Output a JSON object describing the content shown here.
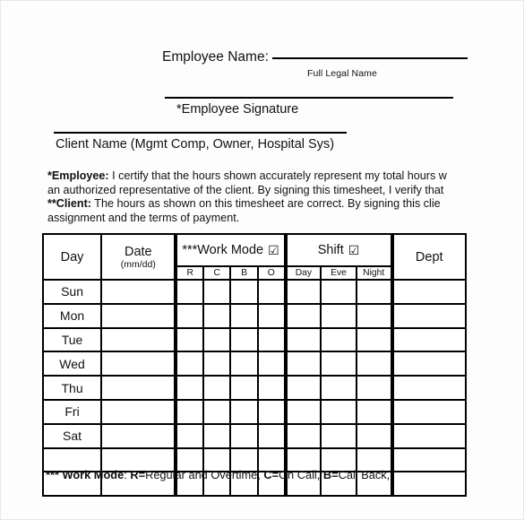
{
  "header": {
    "employee_name_label": "Employee Name:",
    "full_legal_name_caption": "Full Legal Name",
    "employee_signature_label": "*Employee Signature",
    "client_name_label": "Client Name (Mgmt Comp, Owner, Hospital Sys)"
  },
  "certification": {
    "employee_marker": "*Employee:",
    "employee_line1": " I certify that the hours shown accurately represent my total hours w",
    "employee_line2": "an authorized representative of the client. By signing this timesheet, I verify that",
    "client_marker": "**Client:",
    "client_line1": "  The hours as shown on this timesheet are correct.  By signing this clie",
    "client_line2": "assignment and the terms of payment."
  },
  "table": {
    "columns": {
      "day": "Day",
      "date_main": "Date",
      "date_sub": "(mm/dd)",
      "work_mode_group": "***Work Mode",
      "work_mode_checkbox": "☑",
      "shift_group": "Shift",
      "shift_checkbox": "☑",
      "dept": "Dept"
    },
    "work_mode_subcols": [
      "R",
      "C",
      "B",
      "O"
    ],
    "shift_subcols": [
      "Day",
      "Eve",
      "Night"
    ],
    "rows": [
      {
        "day": "Sun"
      },
      {
        "day": "Mon"
      },
      {
        "day": "Tue"
      },
      {
        "day": "Wed"
      },
      {
        "day": "Thu"
      },
      {
        "day": "Fri"
      },
      {
        "day": "Sat"
      },
      {
        "day": ""
      },
      {
        "day": ""
      }
    ]
  },
  "footer": {
    "marker": "*** Work Mode",
    "rest": ": R=Regular and Overtime, C=On Call, B=Call Back,",
    "r_key": "R=",
    "r_text": "Regular and Overtime, ",
    "c_key": "C=",
    "c_text": "On Call, ",
    "b_key": "B=",
    "b_text": "Call Back,"
  },
  "colors": {
    "ink": "#111111",
    "rule": "#000000",
    "page": "#fdfdfd",
    "page_border": "#e8e8e8"
  }
}
